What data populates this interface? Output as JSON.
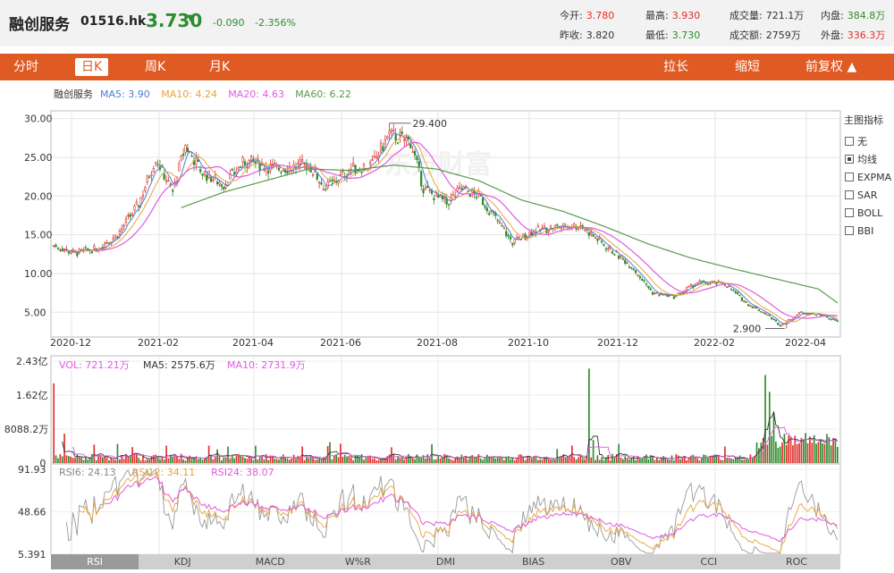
{
  "header": {
    "name": "融创服务",
    "code": "01516.hk",
    "price": "3.730",
    "arrow": "▼",
    "change": "-0.090",
    "change_pct": "-2.356%",
    "stats": [
      {
        "label": "今开:",
        "value": "3.780",
        "tone": "red"
      },
      {
        "label": "最高:",
        "value": "3.930",
        "tone": "red"
      },
      {
        "label": "成交量:",
        "value": "721.1万",
        "tone": "plain"
      },
      {
        "label": "内盘:",
        "value": "384.8万",
        "tone": "green"
      },
      {
        "label": "昨收:",
        "value": "3.820",
        "tone": "plain"
      },
      {
        "label": "最低:",
        "value": "3.730",
        "tone": "green"
      },
      {
        "label": "成交额:",
        "value": "2759万",
        "tone": "plain"
      },
      {
        "label": "外盘:",
        "value": "336.3万",
        "tone": "red"
      }
    ]
  },
  "tabs": {
    "period": [
      "分时",
      "日K",
      "周K",
      "月K"
    ],
    "active_period": "日K",
    "stretch": "拉长",
    "shrink": "缩短",
    "adjust": "前复权 ▲"
  },
  "indicators": {
    "title": "主图指标",
    "items": [
      {
        "label": "无",
        "checked": false
      },
      {
        "label": "均线",
        "checked": true
      },
      {
        "label": "EXPMA",
        "checked": false
      },
      {
        "label": "SAR",
        "checked": false
      },
      {
        "label": "BOLL",
        "checked": false
      },
      {
        "label": "BBI",
        "checked": false
      }
    ]
  },
  "bottom_tabs": [
    "RSI",
    "KDJ",
    "MACD",
    "W%R",
    "DMI",
    "BIAS",
    "OBV",
    "CCI",
    "ROC"
  ],
  "bottom_active": "RSI",
  "colors": {
    "up": "#e0302a",
    "down": "#2e8b2e",
    "ma5": "#4a7fd4",
    "ma10": "#e8a33c",
    "ma20": "#e05ae0",
    "ma60": "#5a9a4a",
    "vol": "#e05ae0"
  },
  "chart_data": [
    {
      "type": "candlestick",
      "legend": [
        {
          "text": "融创服务",
          "color": "#333333"
        },
        {
          "text": "MA5: 3.90",
          "color": "#4a7fd4"
        },
        {
          "text": "MA10: 4.24",
          "color": "#e8a33c"
        },
        {
          "text": "MA20: 4.63",
          "color": "#e05ae0"
        },
        {
          "text": "MA60: 6.22",
          "color": "#5a9a4a"
        }
      ],
      "y_ticks": [
        "30.00",
        "25.00",
        "20.00",
        "15.00",
        "10.00",
        "5.00"
      ],
      "y_tick_values": [
        30,
        25,
        20,
        15,
        10,
        5
      ],
      "ylim": [
        1.8,
        31.0
      ],
      "x_ticks": [
        "2020-12",
        "2021-02",
        "2021-04",
        "2021-06",
        "2021-08",
        "2021-10",
        "2021-12",
        "2022-02",
        "2022-04"
      ],
      "x_tick_index": [
        3,
        46,
        87,
        128,
        172,
        217,
        261,
        303,
        346
      ],
      "n_days": 370,
      "high_marker": {
        "label": "29.400",
        "index": 158
      },
      "low_marker": {
        "label": "2.900",
        "index": 345
      },
      "price_path": [
        [
          0,
          13.6
        ],
        [
          10,
          12.6
        ],
        [
          20,
          13.2
        ],
        [
          30,
          15.0
        ],
        [
          40,
          19.0
        ],
        [
          48,
          25.0
        ],
        [
          56,
          20.5
        ],
        [
          62,
          26.5
        ],
        [
          70,
          23.0
        ],
        [
          80,
          21.5
        ],
        [
          90,
          24.5
        ],
        [
          105,
          23.5
        ],
        [
          120,
          24.0
        ],
        [
          128,
          21.0
        ],
        [
          140,
          23.5
        ],
        [
          150,
          24.0
        ],
        [
          158,
          28.0
        ],
        [
          168,
          27.0
        ],
        [
          174,
          21.0
        ],
        [
          185,
          19.0
        ],
        [
          192,
          21.0
        ],
        [
          200,
          20.0
        ],
        [
          207,
          17.5
        ],
        [
          216,
          14.0
        ],
        [
          226,
          15.5
        ],
        [
          236,
          16.0
        ],
        [
          248,
          16.2
        ],
        [
          260,
          13.5
        ],
        [
          272,
          11.0
        ],
        [
          282,
          7.5
        ],
        [
          292,
          7.0
        ],
        [
          303,
          8.8
        ],
        [
          316,
          8.7
        ],
        [
          326,
          6.2
        ],
        [
          336,
          4.7
        ],
        [
          342,
          3.3
        ],
        [
          352,
          5.0
        ],
        [
          362,
          4.6
        ],
        [
          369,
          3.8
        ]
      ],
      "ma60_path": [
        [
          60,
          18.5
        ],
        [
          80,
          20.5
        ],
        [
          100,
          22.0
        ],
        [
          120,
          23.5
        ],
        [
          140,
          23.3
        ],
        [
          160,
          24.0
        ],
        [
          180,
          23.5
        ],
        [
          200,
          22.0
        ],
        [
          220,
          19.5
        ],
        [
          240,
          18.0
        ],
        [
          260,
          16.0
        ],
        [
          280,
          13.8
        ],
        [
          300,
          12.0
        ],
        [
          320,
          10.6
        ],
        [
          340,
          9.3
        ],
        [
          360,
          8.0
        ],
        [
          369,
          6.2
        ]
      ]
    },
    {
      "type": "bar",
      "legend": [
        {
          "text": "VOL: 721.21万",
          "color": "#e05ae0"
        },
        {
          "text": "MA5: 2575.6万",
          "color": "#333333"
        },
        {
          "text": "MA10: 2731.9万",
          "color": "#e05ae0"
        }
      ],
      "y_ticks": [
        "2.43亿",
        "1.62亿",
        "8088.2万",
        "0"
      ],
      "y_tick_values": [
        24300,
        16200,
        8088.2,
        0
      ],
      "ylim": [
        0,
        24300
      ],
      "unit": "万",
      "spikes": [
        {
          "index": 0,
          "value": 19000
        },
        {
          "index": 252,
          "value": 22500
        },
        {
          "index": 254,
          "value": 5500
        },
        {
          "index": 335,
          "value": 21000
        },
        {
          "index": 337,
          "value": 17000
        },
        {
          "index": 339,
          "value": 12000
        },
        {
          "index": 130,
          "value": 5000
        },
        {
          "index": 5,
          "value": 7000
        }
      ]
    },
    {
      "type": "line",
      "legend": [
        {
          "text": "RSI6: 24.13",
          "color": "#888888"
        },
        {
          "text": "RSI12: 34.11",
          "color": "#e8a33c"
        },
        {
          "text": "RSI24: 38.07",
          "color": "#e05ae0"
        }
      ],
      "y_ticks": [
        "91.93",
        "48.66",
        "5.391"
      ],
      "y_tick_values": [
        91.93,
        48.66,
        5.391
      ],
      "ylim": [
        5.391,
        91.93
      ]
    }
  ]
}
